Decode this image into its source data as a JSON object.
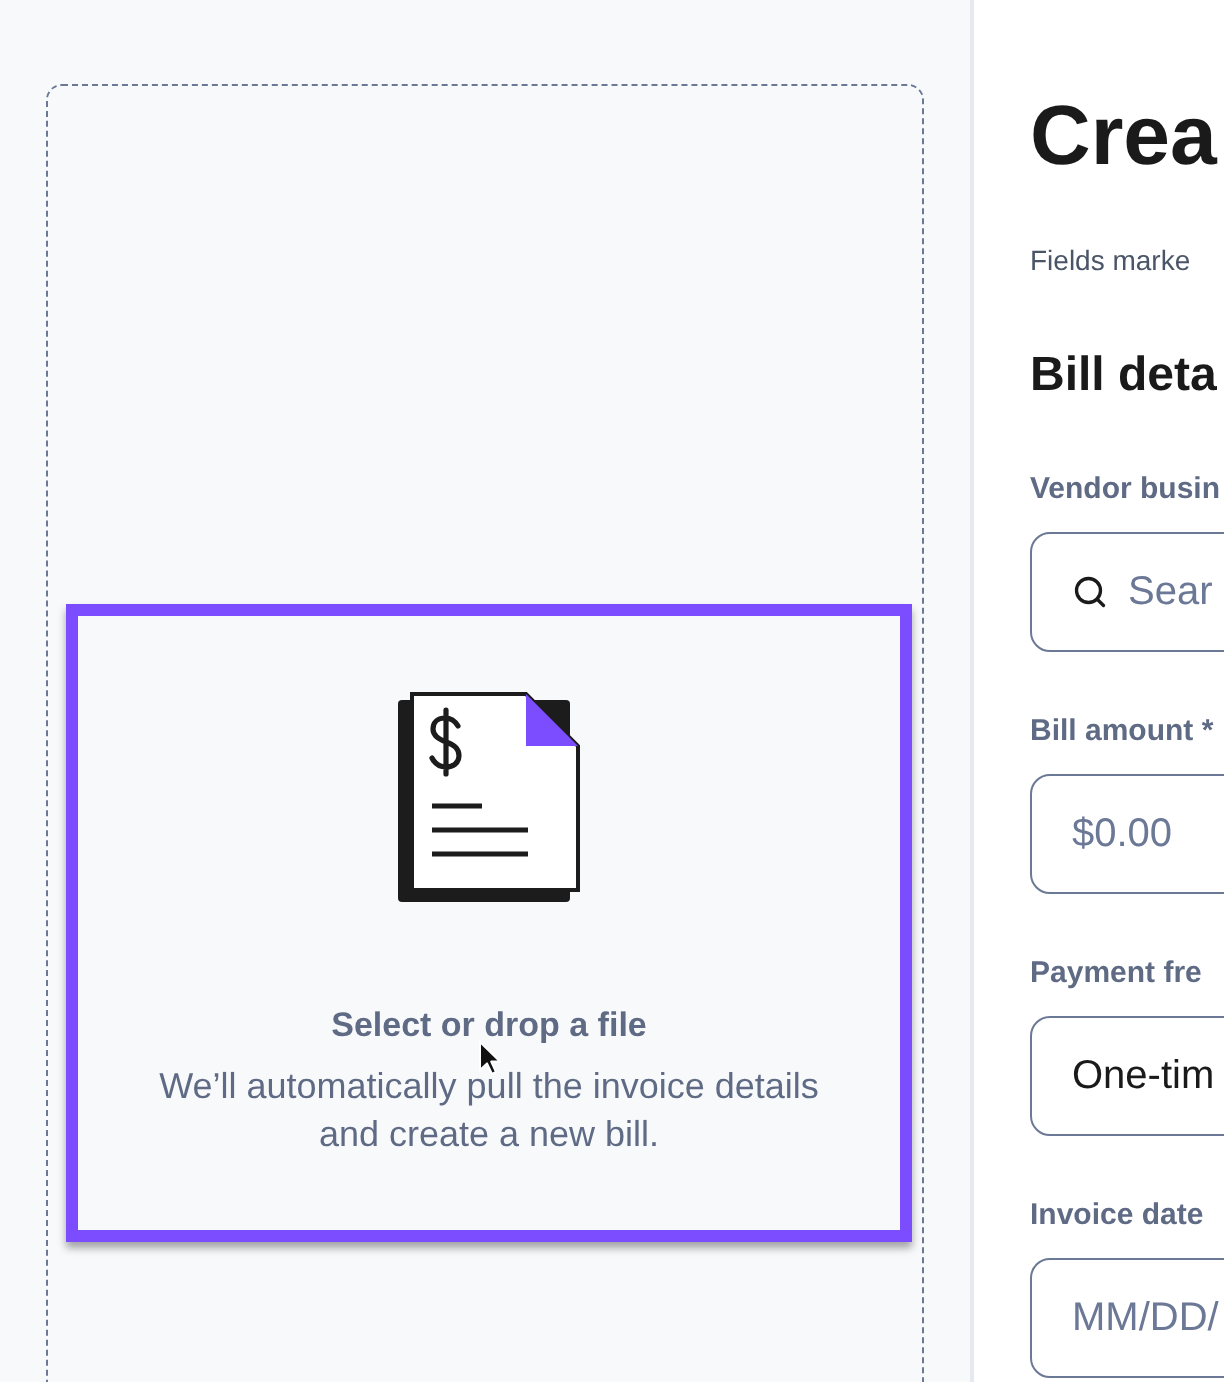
{
  "upload": {
    "drag_over": true,
    "title": "Select or drop a file",
    "description": "We’ll automatically pull the invoice details and create a new bill."
  },
  "form": {
    "title": "Crea",
    "subtitle": "Fields marke",
    "section_title": "Bill deta",
    "fields": [
      {
        "label": "Vendor busin",
        "kind": "search",
        "placeholder": "Sear"
      },
      {
        "label": "Bill amount *",
        "kind": "text",
        "placeholder": "$0.00"
      },
      {
        "label": "Payment fre",
        "kind": "text",
        "value": "One-tim"
      },
      {
        "label": "Invoice date",
        "kind": "text",
        "placeholder": "MM/DD/"
      }
    ]
  }
}
